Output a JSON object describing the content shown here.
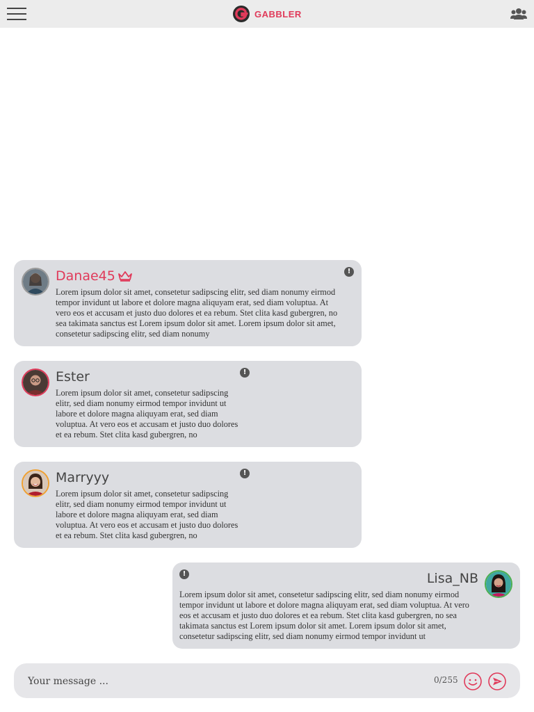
{
  "header": {
    "brand": "GABBLER",
    "menu_icon": "hamburger-menu-icon",
    "users_icon": "users-icon",
    "brand_color": "#e03a5a"
  },
  "messages": [
    {
      "user": "Danae45",
      "badge_icon": "crown-icon",
      "text": "Lorem ipsum dolor sit amet, consetetur sadipscing elitr, sed diam nonumy eirmod tempor invidunt ut labore et dolore magna aliquyam erat, sed diam voluptua. At vero eos et accusam et justo duo dolores et ea rebum. Stet clita kasd gubergren, no sea takimata sanctus est Lorem ipsum dolor sit amet. Lorem ipsum dolor sit amet, consetetur sadipscing elitr, sed diam nonumy"
    },
    {
      "user": "Ester",
      "text": "Lorem ipsum dolor sit amet, consetetur sadipscing elitr, sed diam nonumy eirmod tempor invidunt ut labore et dolore magna aliquyam erat, sed diam voluptua. At vero eos et accusam et justo duo dolores et ea rebum. Stet clita kasd gubergren, no"
    },
    {
      "user": "Marryyy",
      "text": "Lorem ipsum dolor sit amet, consetetur sadipscing elitr, sed diam nonumy eirmod tempor invidunt ut labore et dolore magna aliquyam erat, sed diam voluptua. At vero eos et accusam et justo duo dolores et ea rebum. Stet clita kasd gubergren, no"
    },
    {
      "user": "Lisa_NB",
      "text": "Lorem ipsum dolor sit amet, consetetur sadipscing elitr, sed diam nonumy eirmod tempor invidunt ut labore et dolore magna aliquyam erat, sed diam voluptua. At vero eos et accusam et justo duo dolores et ea rebum. Stet clita kasd gubergren, no sea takimata sanctus est Lorem ipsum dolor sit amet. Lorem ipsum dolor sit amet, consetetur sadipscing elitr, sed diam nonumy eirmod tempor invidunt ut"
    }
  ],
  "composer": {
    "placeholder": "Your message ...",
    "counter": "0/255",
    "emoji_icon": "emoji-icon",
    "send_icon": "send-icon"
  }
}
